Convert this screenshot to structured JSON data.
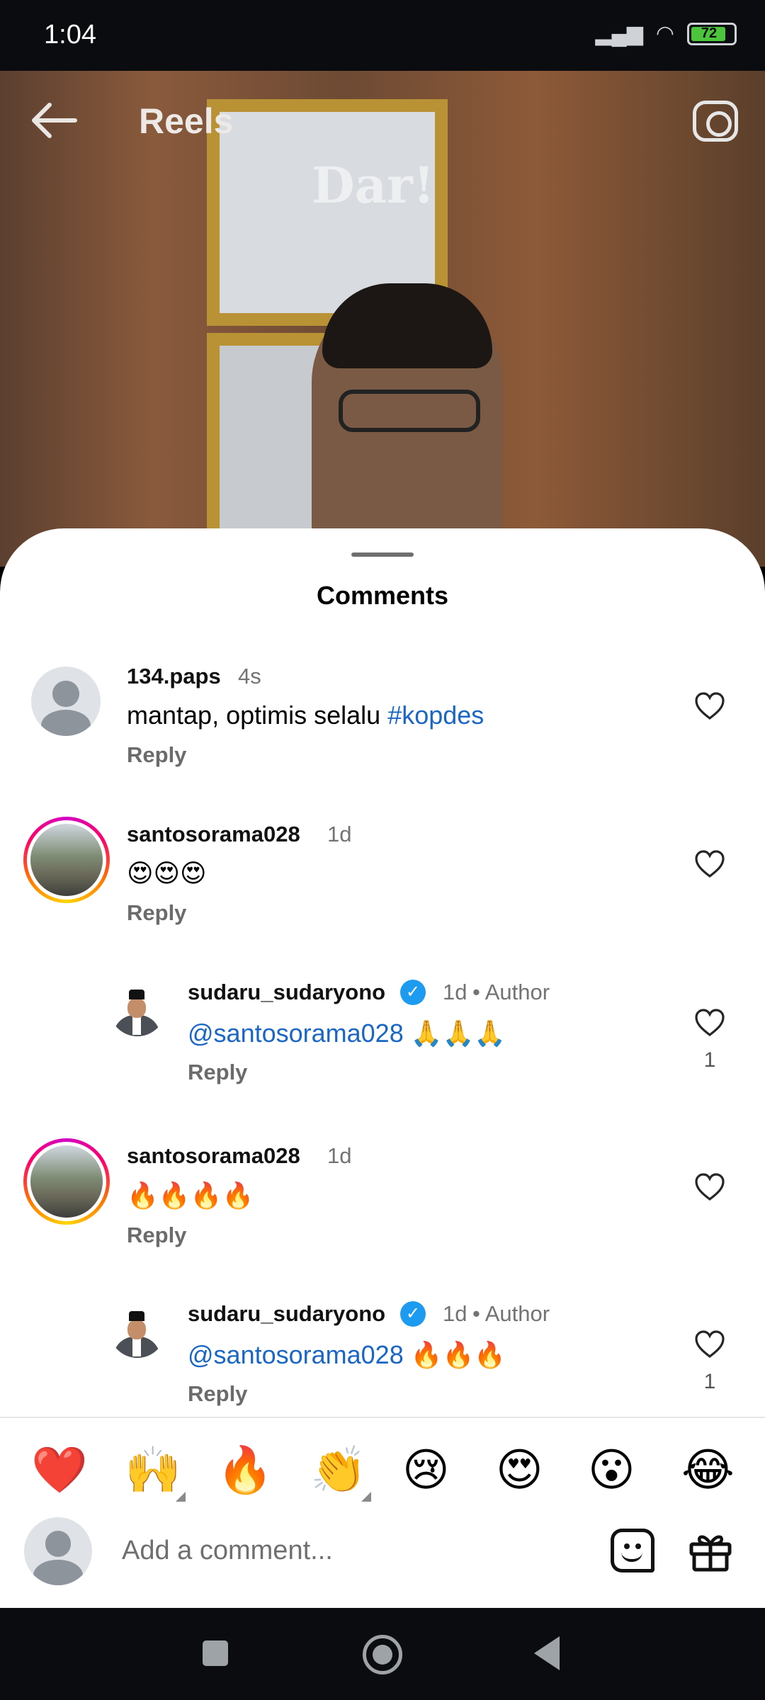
{
  "status_bar": {
    "time": "1:04",
    "battery": "72"
  },
  "header": {
    "title": "Reels",
    "watermark": "Dar!"
  },
  "sheet": {
    "title": "Comments"
  },
  "comments": [
    {
      "username": "134.paps",
      "time": "4s",
      "text": "mantap, optimis selalu ",
      "hashtag": "#kopdes",
      "reply": "Reply"
    },
    {
      "username": "santosorama028",
      "time": "1d",
      "text": "😍😍😍",
      "reply": "Reply"
    },
    {
      "username": "sudaru_sudaryono",
      "time": "1d",
      "author": "• Author",
      "mention": "@santosorama028",
      "text": " 🙏🙏🙏",
      "reply": "Reply",
      "likes": "1"
    },
    {
      "username": "santosorama028",
      "time": "1d",
      "text": "🔥🔥🔥🔥",
      "reply": "Reply"
    },
    {
      "username": "sudaru_sudaryono",
      "time": "1d",
      "author": "• Author",
      "mention": "@santosorama028",
      "text": " 🔥🔥🔥",
      "reply": "Reply",
      "likes": "1"
    }
  ],
  "reactions": [
    "❤️",
    "🙌",
    "🔥",
    "👏",
    "😢",
    "😍",
    "😮",
    "😂"
  ],
  "composer": {
    "placeholder": "Add a comment..."
  },
  "icons": {
    "back": "back-arrow-icon",
    "camera": "camera-icon",
    "heart": "heart-outline-icon",
    "verified": "verified-badge-icon",
    "sticker": "sticker-icon",
    "gift": "gift-icon"
  },
  "colors": {
    "link": "#1a66c5",
    "verified": "#1d9bf0",
    "muted": "#737373"
  }
}
